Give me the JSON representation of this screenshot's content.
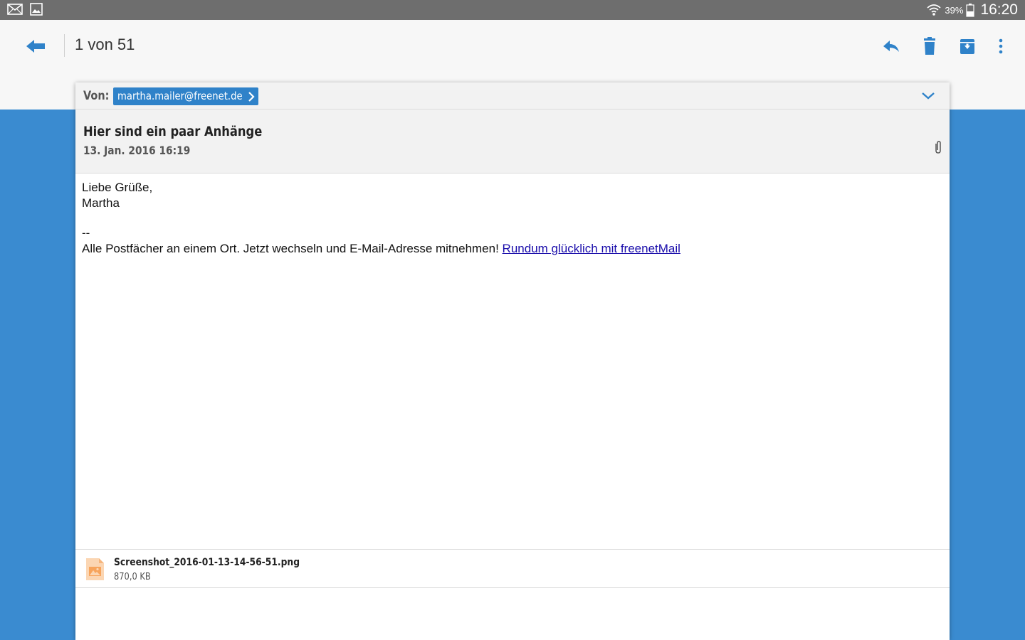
{
  "status_bar": {
    "notification_icons": [
      "mail-icon",
      "gallery-icon"
    ],
    "battery_percent": "39%",
    "time": "16:20"
  },
  "toolbar": {
    "counter": "1 von 51",
    "actions": [
      "reply-icon",
      "delete-icon",
      "archive-icon",
      "more-icon"
    ],
    "accent_color": "#2f82c9"
  },
  "message": {
    "from_label": "Von:",
    "sender": "martha.mailer@freenet.de",
    "subject": "Hier sind ein paar Anhänge",
    "date": "13. Jan. 2016 16:19",
    "body": {
      "greeting": "Liebe Grüße,",
      "signature_name": "Martha",
      "separator": "--",
      "footer_text": "Alle Postfächer an einem Ort. Jetzt wechseln und E-Mail-Adresse mitnehmen! ",
      "footer_link": "Rundum glücklich mit freenetMail"
    },
    "attachment": {
      "filename": "Screenshot_2016-01-13-14-56-51.png",
      "size": "870,0 KB"
    }
  },
  "colors": {
    "background": "#3a8bd0",
    "status_bar": "#6e6e6e",
    "toolbar": "#f7f7f7",
    "header_area": "#f2f2f2"
  }
}
